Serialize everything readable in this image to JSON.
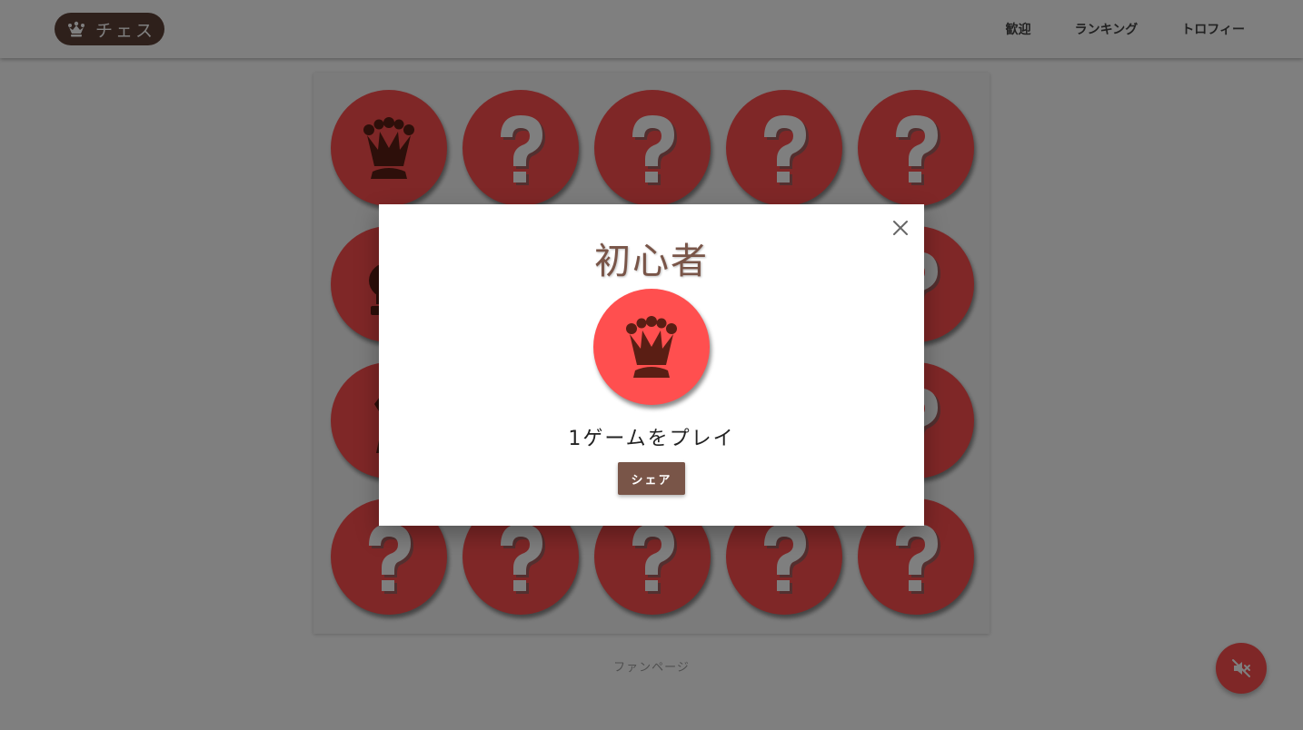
{
  "header": {
    "logo_text": "チェス",
    "logo_icon": "crown-icon",
    "nav": [
      {
        "label": "歓迎"
      },
      {
        "label": "ランキング"
      },
      {
        "label": "トロフィー"
      }
    ]
  },
  "board": {
    "trophies": [
      {
        "icon": "queen",
        "unlocked": true
      },
      {
        "icon": "question",
        "unlocked": false
      },
      {
        "icon": "question",
        "unlocked": false
      },
      {
        "icon": "question",
        "unlocked": false
      },
      {
        "icon": "question",
        "unlocked": false
      },
      {
        "icon": "king",
        "unlocked": true
      },
      {
        "icon": "unknown",
        "unlocked": false
      },
      {
        "icon": "unknown",
        "unlocked": false
      },
      {
        "icon": "unknown",
        "unlocked": false
      },
      {
        "icon": "question",
        "unlocked": false
      },
      {
        "icon": "knight",
        "unlocked": true
      },
      {
        "icon": "unknown",
        "unlocked": false
      },
      {
        "icon": "unknown",
        "unlocked": false
      },
      {
        "icon": "unknown",
        "unlocked": false
      },
      {
        "icon": "question",
        "unlocked": false
      },
      {
        "icon": "question",
        "unlocked": false
      },
      {
        "icon": "question",
        "unlocked": false
      },
      {
        "icon": "question",
        "unlocked": false
      },
      {
        "icon": "question",
        "unlocked": false
      },
      {
        "icon": "question",
        "unlocked": false
      }
    ]
  },
  "footer": {
    "link": "ファンページ"
  },
  "fab": {
    "icon": "volume-off-icon"
  },
  "modal": {
    "title": "初心者",
    "icon": "queen",
    "description": "1ゲームをプレイ",
    "share_label": "シェア",
    "close_icon": "close-icon"
  },
  "colors": {
    "coin": "#ff4f4f",
    "piece": "#5a1e14",
    "brand": "#795548",
    "logo_bg": "#5d4037",
    "question": "#ffffff"
  }
}
